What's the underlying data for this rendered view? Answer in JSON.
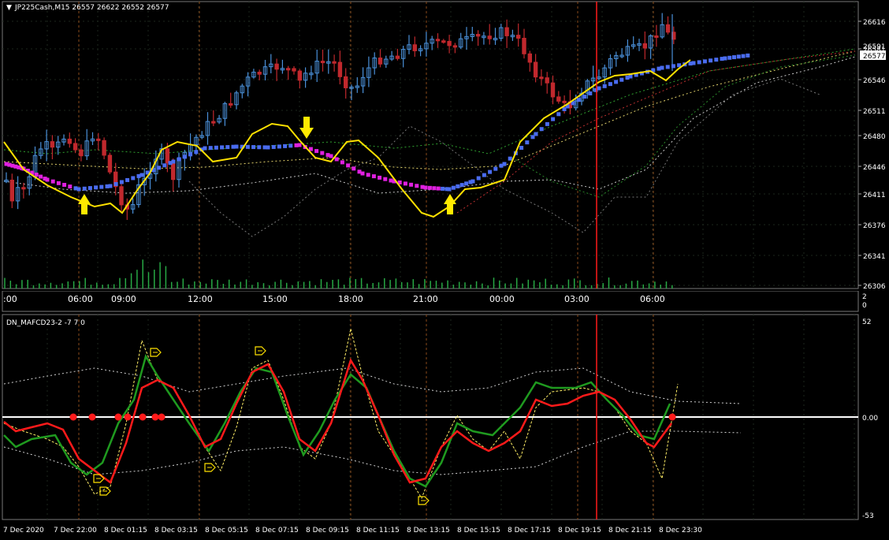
{
  "symbol_header": "JP225Cash,M15  26557 26622 26552 26577",
  "price_scale": [
    "26616",
    "26581",
    "26546",
    "26511",
    "26480",
    "26446",
    "26411",
    "26376",
    "26341",
    "26306"
  ],
  "current_price_label": "26577",
  "hidden_price_label": "26591",
  "time_axis": [
    ":00",
    "06:00",
    "09:00",
    "12:00",
    "15:00",
    "18:00",
    "21:00",
    "00:00",
    "03:00",
    "06:00"
  ],
  "volume_scale": [
    "2",
    "0"
  ],
  "indicator": {
    "title": "DN_MAFCD23-2 -7 7 0",
    "scale_top": "52",
    "scale_zero": "0.00",
    "scale_bottom": "-53"
  },
  "date_axis": [
    "7 Dec 2020",
    "7 Dec 22:00",
    "8 Dec 01:15",
    "8 Dec 03:15",
    "8 Dec 05:15",
    "8 Dec 07:15",
    "8 Dec 09:15",
    "8 Dec 11:15",
    "8 Dec 13:15",
    "8 Dec 15:15",
    "8 Dec 17:15",
    "8 Dec 19:15",
    "8 Dec 21:15",
    "8 Dec 23:30"
  ],
  "colors": {
    "background": "#000000",
    "grid": "#1f2a1f",
    "bull_candle": "#4a90d9",
    "bear_candle": "#c0282d",
    "volume": "#27a844",
    "ma_uptrend": "#4a6cf0",
    "ma_downtrend": "#e020e0",
    "fast_line": "#ffe100",
    "signal_arrow": "#ffea00",
    "cursor_line": "#ff1a1a",
    "osc_green": "#1f9a1f",
    "osc_red": "#ff1a1a",
    "zero_line": "#ffffff"
  }
}
